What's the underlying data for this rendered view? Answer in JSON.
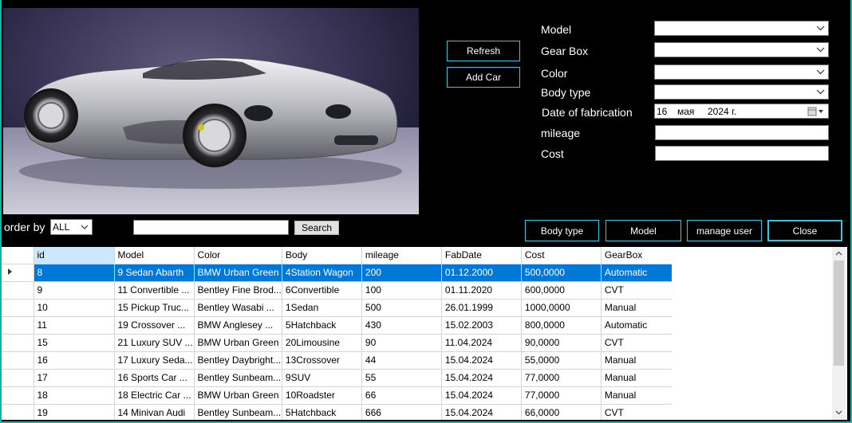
{
  "buttons": {
    "refresh": "Refresh",
    "add_car": "Add Car",
    "body_type": "Body type",
    "model": "Model",
    "manage_user": "manage user",
    "close": "Close",
    "search": "Search"
  },
  "form": {
    "model_label": "Model",
    "gearbox_label": "Gear Box",
    "color_label": "Color",
    "body_type_label": "Body type",
    "date_label": "Date of fabrication",
    "mileage_label": "mileage",
    "cost_label": "Cost",
    "date_day": "16",
    "date_month": "мая",
    "date_year": "2024 г."
  },
  "order": {
    "label": "order by",
    "value": "ALL"
  },
  "grid": {
    "columns": [
      "id",
      "Model",
      "Color",
      "Body",
      "mileage",
      "FabDate",
      "Cost",
      "GearBox"
    ],
    "rows": [
      [
        "8",
        "9   Sedan   Abarth",
        "BMW Urban Green",
        "4Station Wagon",
        "200",
        "01.12.2000",
        "500,0000",
        "Automatic"
      ],
      [
        "9",
        "11   Convertible   ...",
        "Bentley Fine Brod...",
        "6Convertible",
        "100",
        "01.11.2020",
        "600,0000",
        "CVT"
      ],
      [
        "10",
        "15   Pickup Truc...",
        "Bentley Wasabi ...",
        "1Sedan",
        "500",
        "26.01.1999",
        "1000,0000",
        "Manual"
      ],
      [
        "11",
        "19   Crossover   ...",
        "BMW Anglesey ...",
        "5Hatchback",
        "430",
        "15.02.2003",
        "800,0000",
        "Automatic"
      ],
      [
        "15",
        "21   Luxury SUV  ...",
        "BMW Urban Green",
        "20Limousine",
        "90",
        "11.04.2024",
        "90,0000",
        "CVT"
      ],
      [
        "16",
        "17   Luxury Seda...",
        "Bentley Daybright...",
        "13Crossover",
        "44",
        "15.04.2024",
        "55,0000",
        "Manual"
      ],
      [
        "17",
        "16   Sports Car   ...",
        "Bentley Sunbeam...",
        "9SUV",
        "55",
        "15.04.2024",
        "77,0000",
        "Manual"
      ],
      [
        "18",
        "18   Electric Car  ...",
        "BMW Urban Green",
        "10Roadster",
        "66",
        "15.04.2024",
        "77,0000",
        "Manual"
      ],
      [
        "19",
        "14   Minivan   Audi",
        "Bentley Sunbeam...",
        "5Hatchback",
        "666",
        "15.04.2024",
        "66,0000",
        "CVT"
      ]
    ]
  },
  "colors": {
    "accent_border": "#2ec7e6",
    "selection": "#0078d7",
    "window_border": "#0fb5a6"
  }
}
